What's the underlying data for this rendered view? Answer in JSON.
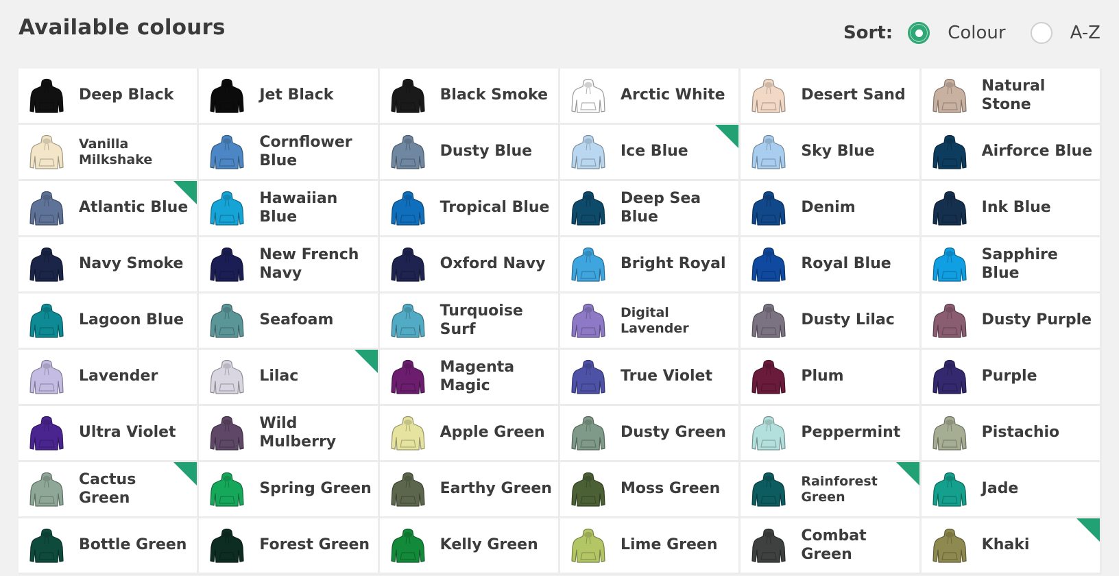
{
  "header": {
    "title": "Available colours",
    "sort_label": "Sort:",
    "options": [
      {
        "label": "Colour",
        "selected": true
      },
      {
        "label": "A-Z",
        "selected": false
      }
    ]
  },
  "accent_color": "#22a274",
  "hoodie_icon": "hoodie-icon",
  "colours": [
    {
      "name": "Deep Black",
      "hex": "#111111",
      "corner": false
    },
    {
      "name": "Jet Black",
      "hex": "#0c0c0c",
      "corner": false
    },
    {
      "name": "Black Smoke",
      "hex": "#1a1a1a",
      "corner": false
    },
    {
      "name": "Arctic White",
      "hex": "#ffffff",
      "corner": false
    },
    {
      "name": "Desert Sand",
      "hex": "#f2d9c6",
      "corner": false
    },
    {
      "name": "Natural Stone",
      "hex": "#c9b1a2",
      "corner": false
    },
    {
      "name": "Vanilla Milkshake",
      "hex": "#f3e6c8",
      "corner": false,
      "small": true
    },
    {
      "name": "Cornflower Blue",
      "hex": "#4c86c4",
      "corner": false
    },
    {
      "name": "Dusty Blue",
      "hex": "#6f87a0",
      "corner": false
    },
    {
      "name": "Ice Blue",
      "hex": "#b9d7f0",
      "corner": true
    },
    {
      "name": "Sky Blue",
      "hex": "#a9cdee",
      "corner": false
    },
    {
      "name": "Airforce Blue",
      "hex": "#0d3c5e",
      "corner": false
    },
    {
      "name": "Atlantic Blue",
      "hex": "#5f7297",
      "corner": true
    },
    {
      "name": "Hawaiian Blue",
      "hex": "#16a3d6",
      "corner": false
    },
    {
      "name": "Tropical Blue",
      "hex": "#0f6fbc",
      "corner": false
    },
    {
      "name": "Deep Sea Blue",
      "hex": "#0e4a6a",
      "corner": false
    },
    {
      "name": "Denim",
      "hex": "#10488a",
      "corner": false
    },
    {
      "name": "Ink Blue",
      "hex": "#14304e",
      "corner": false
    },
    {
      "name": "Navy Smoke",
      "hex": "#1a2548",
      "corner": false
    },
    {
      "name": "New French Navy",
      "hex": "#1b1e55",
      "corner": false
    },
    {
      "name": "Oxford Navy",
      "hex": "#1e2350",
      "corner": false
    },
    {
      "name": "Bright Royal",
      "hex": "#3ea5de",
      "corner": false
    },
    {
      "name": "Royal Blue",
      "hex": "#0f4aa0",
      "corner": false
    },
    {
      "name": "Sapphire Blue",
      "hex": "#109fe3",
      "corner": false
    },
    {
      "name": "Lagoon Blue",
      "hex": "#0d8a93",
      "corner": false
    },
    {
      "name": "Seafoam",
      "hex": "#5a9598",
      "corner": false
    },
    {
      "name": "Turquoise Surf",
      "hex": "#52abc4",
      "corner": false
    },
    {
      "name": "Digital Lavender",
      "hex": "#8d79c6",
      "corner": false,
      "small": true
    },
    {
      "name": "Dusty Lilac",
      "hex": "#7b7382",
      "corner": false
    },
    {
      "name": "Dusty Purple",
      "hex": "#8a5d70",
      "corner": false
    },
    {
      "name": "Lavender",
      "hex": "#c4bce2",
      "corner": false
    },
    {
      "name": "Lilac",
      "hex": "#d9d6e2",
      "corner": true
    },
    {
      "name": "Magenta Magic",
      "hex": "#6c1d6e",
      "corner": false
    },
    {
      "name": "True Violet",
      "hex": "#4e52a6",
      "corner": false
    },
    {
      "name": "Plum",
      "hex": "#6a1b3b",
      "corner": false
    },
    {
      "name": "Purple",
      "hex": "#34286e",
      "corner": false
    },
    {
      "name": "Ultra Violet",
      "hex": "#4a2590",
      "corner": false
    },
    {
      "name": "Wild Mulberry",
      "hex": "#5e4767",
      "corner": false
    },
    {
      "name": "Apple Green",
      "hex": "#e5e39e",
      "corner": false
    },
    {
      "name": "Dusty Green",
      "hex": "#7f9a88",
      "corner": false
    },
    {
      "name": "Peppermint",
      "hex": "#b3e0dd",
      "corner": false
    },
    {
      "name": "Pistachio",
      "hex": "#a5ad92",
      "corner": false
    },
    {
      "name": "Cactus Green",
      "hex": "#8ea797",
      "corner": true
    },
    {
      "name": "Spring Green",
      "hex": "#16a85a",
      "corner": false
    },
    {
      "name": "Earthy Green",
      "hex": "#5c664c",
      "corner": false
    },
    {
      "name": "Moss Green",
      "hex": "#4c6035",
      "corner": false
    },
    {
      "name": "Rainforest Green",
      "hex": "#0d5c60",
      "corner": true,
      "small": true
    },
    {
      "name": "Jade",
      "hex": "#14a08c",
      "corner": false
    },
    {
      "name": "Bottle Green",
      "hex": "#0f4b3c",
      "corner": false
    },
    {
      "name": "Forest Green",
      "hex": "#0d2c22",
      "corner": false
    },
    {
      "name": "Kelly Green",
      "hex": "#138a3a",
      "corner": false
    },
    {
      "name": "Lime Green",
      "hex": "#b3c665",
      "corner": false
    },
    {
      "name": "Combat Green",
      "hex": "#3e4140",
      "corner": false
    },
    {
      "name": "Khaki",
      "hex": "#8e8a4f",
      "corner": true
    }
  ]
}
